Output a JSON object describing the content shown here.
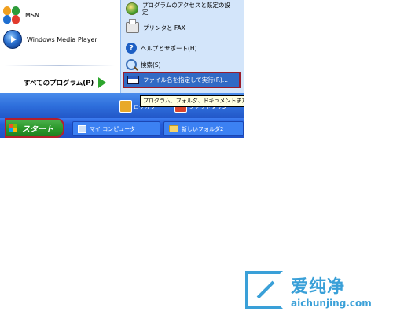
{
  "start_menu": {
    "pinned": [
      {
        "label": "MSN",
        "icon": "msn-butterfly-icon"
      },
      {
        "label": "Windows Media Player",
        "icon": "media-player-icon"
      }
    ],
    "all_programs_label": "すべてのプログラム(P)",
    "right_items": [
      {
        "label": "プログラムのアクセスと既定の設定",
        "icon": "program-access-icon"
      },
      {
        "label": "プリンタと FAX",
        "icon": "printer-icon"
      },
      {
        "label": "ヘルプとサポート(H)",
        "icon": "help-icon"
      },
      {
        "label": "検索(S)",
        "icon": "search-icon"
      },
      {
        "label": "ファイル名を指定して実行(R)...",
        "icon": "run-icon"
      }
    ],
    "logoff_label": "ログオフ",
    "shutdown_label": "シャットダウン"
  },
  "tooltip": {
    "text": "プログラム、フォルダ、ドキュメントまた"
  },
  "taskbar": {
    "start_label": "スタート",
    "buttons": [
      {
        "label": "マイ コンピュータ",
        "icon": "computer-icon"
      },
      {
        "label": "新しいフォルダ2",
        "icon": "folder-icon"
      }
    ]
  },
  "watermark": {
    "brand": "爱纯净",
    "url": "aichunjing.com"
  },
  "colors": {
    "taskbar_blue": "#245edb",
    "start_green": "#2c9a2c",
    "highlight_red": "#b3202d",
    "menu_right_bg": "#d3e5fa",
    "watermark_blue": "#3aa0d8"
  }
}
